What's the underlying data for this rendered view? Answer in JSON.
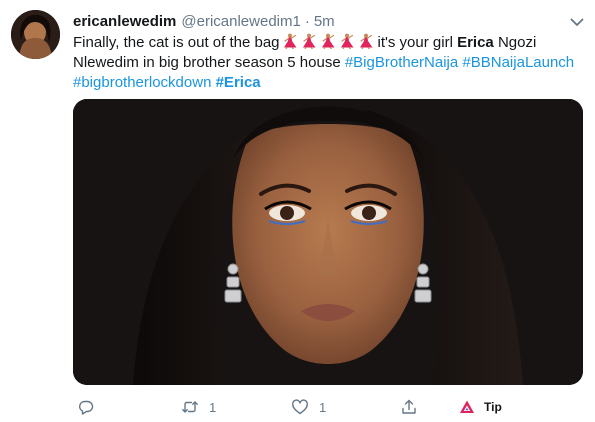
{
  "author": {
    "display_name": "ericanlewedim",
    "handle": "@ericanlewedim1",
    "separator": "·",
    "time": "5m"
  },
  "tweet": {
    "text_part1": "Finally, the cat is out of the bag",
    "emoji_name": "woman-dancing-emoji",
    "emoji_count": 5,
    "text_part2": "it's your girl",
    "bold_name": "Erica",
    "text_part3": "Ngozi",
    "text_line2": "Nlewedim in big brother season 5 house",
    "hashtags": [
      "#BigBrotherNaija",
      "#BBNaijaLaunch",
      "#bigbrotherlockdown",
      "#Erica"
    ]
  },
  "actions": {
    "reply_count": "",
    "retweet_count": "1",
    "like_count": "1",
    "tip_label": "Tip"
  },
  "colors": {
    "link": "#1b95e0",
    "muted": "#657786",
    "text": "#14171a",
    "emoji": "#e0245e"
  },
  "icons": {
    "reply": "reply-icon",
    "retweet": "retweet-icon",
    "like": "heart-icon",
    "share": "share-icon",
    "tip": "tip-icon",
    "more": "chevron-down-icon"
  }
}
